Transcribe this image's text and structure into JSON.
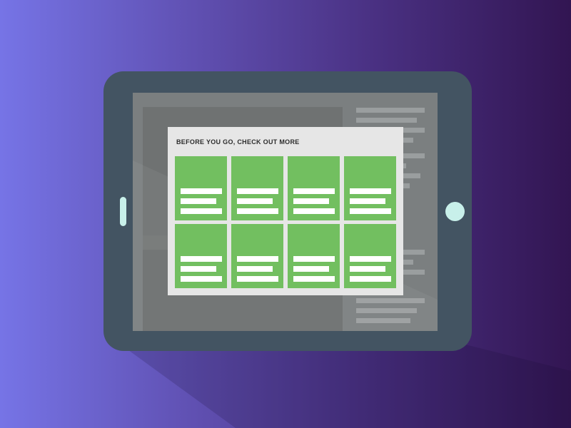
{
  "modal": {
    "title": "BEFORE YOU GO, CHECK OUT MORE",
    "cards": [
      {
        "id": 1
      },
      {
        "id": 2
      },
      {
        "id": 3
      },
      {
        "id": 4
      },
      {
        "id": 5
      },
      {
        "id": 6
      },
      {
        "id": 7
      },
      {
        "id": 8
      }
    ]
  },
  "colors": {
    "tablet_frame": "#435462",
    "buttons": "#c8f0ea",
    "card": "#72bf60",
    "modal_background": "#e6e6e6"
  }
}
